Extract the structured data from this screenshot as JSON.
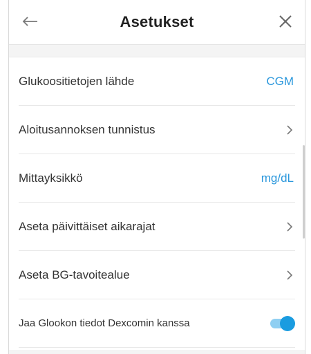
{
  "header": {
    "title": "Asetukset",
    "back_icon": "arrow-left-icon",
    "close_icon": "close-icon"
  },
  "settings": {
    "glucose_source": {
      "label": "Glukoositietojen lähde",
      "value": "CGM"
    },
    "initial_dose": {
      "label": "Aloitusannoksen tunnistus",
      "icon": "chevron-right-icon"
    },
    "unit": {
      "label": "Mittayksikkö",
      "value": "mg/dL"
    },
    "daily_limits": {
      "label": "Aseta päivittäiset aikarajat",
      "icon": "chevron-right-icon"
    },
    "bg_target": {
      "label": "Aseta BG-tavoitealue",
      "icon": "chevron-right-icon"
    },
    "dexcom_share": {
      "label": "Jaa Glookon tiedot Dexcomin kanssa",
      "enabled": true
    }
  },
  "colors": {
    "accent": "#2a97dc",
    "toggle_on": "#1a9ce0",
    "toggle_track": "#8fcff2"
  }
}
